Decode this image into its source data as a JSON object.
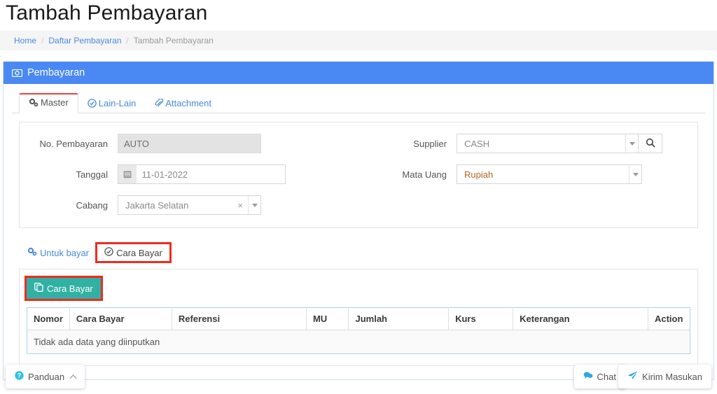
{
  "page": {
    "title": "Tambah Pembayaran"
  },
  "breadcrumb": {
    "home": "Home",
    "list": "Daftar Pembayaran",
    "current": "Tambah Pembayaran",
    "separator": "/"
  },
  "panel": {
    "header_title": "Pembayaran",
    "header_icon": "banknote-icon",
    "header_color": "#4a89f3"
  },
  "tabs": [
    {
      "label": "Master",
      "icon": "gears-icon",
      "active": true
    },
    {
      "label": "Lain-Lain",
      "icon": "check-circle-icon",
      "active": false
    },
    {
      "label": "Attachment",
      "icon": "paperclip-icon",
      "active": false
    }
  ],
  "form": {
    "left": [
      {
        "label": "No. Pembayaran",
        "value": "AUTO",
        "type": "readonly"
      },
      {
        "label": "Tanggal",
        "value": "11-01-2022",
        "type": "date",
        "icon": "calendar-icon"
      },
      {
        "label": "Cabang",
        "value": "Jakarta Selatan",
        "type": "select2",
        "clear": "×"
      }
    ],
    "right": [
      {
        "label": "Supplier",
        "value": "CASH",
        "type": "select-search",
        "search_icon": "search-icon"
      },
      {
        "label": "Mata Uang",
        "value": "Rupiah",
        "type": "select"
      }
    ]
  },
  "subtabs": [
    {
      "label": "Untuk bayar",
      "icon": "gears-icon",
      "highlight": false
    },
    {
      "label": "Cara Bayar",
      "icon": "check-circle-icon",
      "highlight": true
    }
  ],
  "detail": {
    "add_button": {
      "label": "Cara Bayar",
      "icon": "copy-icon",
      "color": "#31b0a4",
      "highlight_color": "#ef2b20"
    },
    "columns": [
      "Nomor",
      "Cara Bayar",
      "Referensi",
      "MU",
      "Jumlah",
      "Kurs",
      "Keterangan",
      "Action"
    ],
    "empty_message": "Tidak ada data yang diinputkan"
  },
  "footer": {
    "panduan": {
      "label": "Panduan",
      "icon": "question-circle-icon",
      "chevron": "chevron-up-icon"
    },
    "chat": {
      "label": "Chat",
      "icon": "chat-bubble-icon"
    },
    "masukan": {
      "label": "Kirim Masukan",
      "icon": "paper-plane-icon"
    }
  }
}
